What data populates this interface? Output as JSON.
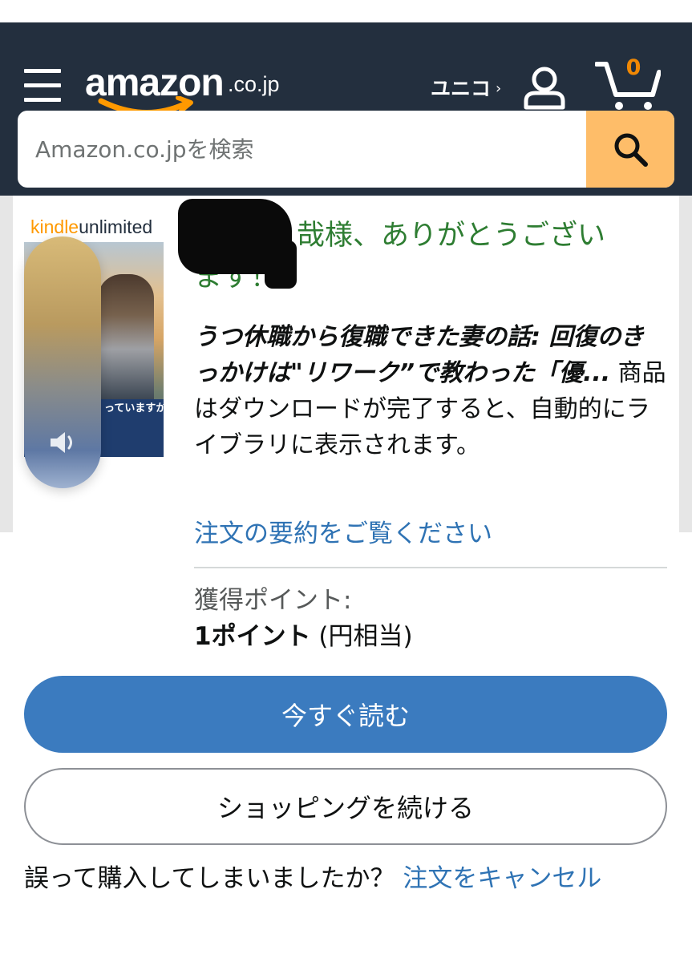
{
  "header": {
    "logo_word": "amazon",
    "logo_tld": ".co.jp",
    "account_name": "ユニコ",
    "account_chevron": "›",
    "cart_count": "0",
    "icons": [
      "menu-icon",
      "user-icon",
      "cart-icon",
      "search-icon"
    ]
  },
  "search": {
    "placeholder": "Amazon.co.jpを検索"
  },
  "book": {
    "badge_kindle": "kindle",
    "badge_unlimited": "unlimited",
    "cover_text": "っていますか?"
  },
  "confirmation": {
    "thanks_line1": "哉様、ありがとうござい",
    "thanks_line2": "ます！",
    "title": "うつ休職から復職できた妻の話: 回復のきっかけは\"リワーク”で教わった「優...",
    "message": " 商品はダウンロードが完了すると、自動的にライブラリに表示されます。",
    "summary_link": "注文の要約をご覧ください"
  },
  "points": {
    "label": "獲得ポイント:",
    "value": "1ポイント",
    "equivalent": " (円相当)"
  },
  "actions": {
    "read_now": "今すぐ読む",
    "continue_shopping": "ショッピングを続ける"
  },
  "cancel": {
    "question": "誤って購入してしまいましたか？ ",
    "link": "注文をキャンセル"
  },
  "colors": {
    "header_bg": "#232f3e",
    "search_button": "#febd69",
    "cart_count": "#f08804",
    "thanks_green": "#2e7d32",
    "link_blue": "#2f73b4",
    "primary_button": "#3b7bbf"
  }
}
